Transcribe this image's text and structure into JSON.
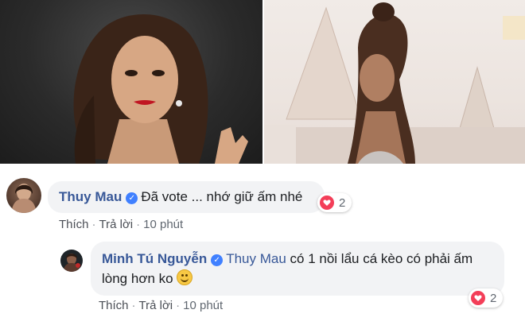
{
  "photos": [
    {
      "name": "left-photo"
    },
    {
      "name": "right-photo"
    }
  ],
  "comments": [
    {
      "author": "Thuy Mau",
      "text": "Đã vote ... nhớ giữ ấm nhé",
      "reactions": {
        "type": "heart-icon",
        "count": "2"
      },
      "actions": {
        "like": "Thích",
        "reply": "Trả lời",
        "time": "10 phút"
      }
    }
  ],
  "reply": {
    "author": "Minh Tú Nguyễn",
    "mention": "Thuy Mau",
    "text_line1": " có 1 nồi lẩu cá kèo có phải ấm",
    "text_line2": "lòng hơn ko",
    "reactions": {
      "type": "heart-icon",
      "count": "2"
    },
    "actions": {
      "like": "Thích",
      "reply": "Trả lời",
      "time": "10 phút"
    }
  },
  "colors": {
    "link": "#385898",
    "bubble": "#f2f3f5",
    "heart": "#f33e58",
    "verified": "#4080ff"
  }
}
